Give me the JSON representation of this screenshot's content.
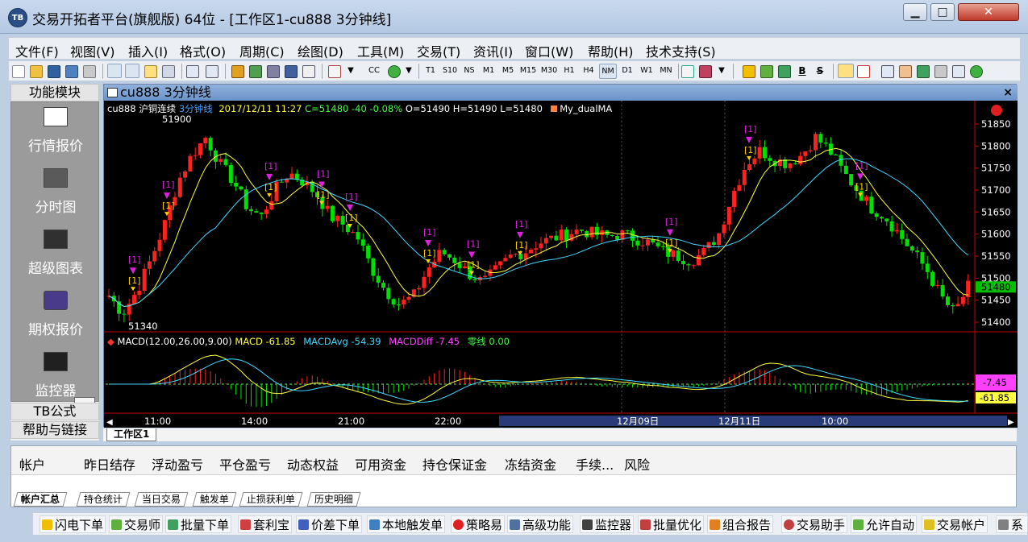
{
  "window": {
    "app_icon_text": "TB",
    "title": "交易开拓者平台(旗舰版) 64位 - [工作区1-cu888 3分钟线]",
    "min_label": "▁",
    "max_label": "□",
    "close_label": "✕"
  },
  "menu": [
    "文件(F)",
    "视图(V)",
    "插入(I)",
    "格式(O)",
    "周期(C)",
    "绘图(D)",
    "工具(M)",
    "交易(T)",
    "资讯(I)",
    "窗口(W)",
    "帮助(H)",
    "技术支持(S)"
  ],
  "toolbar": {
    "cc_label": "CC",
    "periods": [
      "T1",
      "S10",
      "NS",
      "M1",
      "M5",
      "M15",
      "M30",
      "H1",
      "H4",
      "NM",
      "D1",
      "W1",
      "MN"
    ],
    "active_period": "NM",
    "b_label": "B",
    "s_label": "S"
  },
  "sidebar": {
    "header": "功能模块",
    "items": [
      "行情报价",
      "分时图",
      "超级图表",
      "期权报价",
      "监控器"
    ],
    "scroll_glyph": "▼",
    "footer_items": [
      "TB公式",
      "帮助与链接"
    ]
  },
  "chart": {
    "window_title": "cu888 3分钟线",
    "close_label": "×",
    "info": {
      "symbol": "cu888 沪铜连续",
      "period": "3分钟线",
      "datetime": "2017/12/11 11:27",
      "close": "C=51480",
      "change": "-40",
      "change_pct": "-0.08%",
      "ohl": "O=51490 H=51490 L=51480",
      "indicator": "My_dualMA"
    },
    "macd_info": {
      "name": "MACD(12.00,26.00,9.00)",
      "macd": "MACD -61.85",
      "avg": "MACDAvg -54.39",
      "diff": "MACDDiff -7.45",
      "zero": "零线 0.00"
    },
    "price_labels": [
      "51850",
      "51800",
      "51750",
      "51700",
      "51650",
      "51600",
      "51550",
      "51500",
      "51450",
      "51400"
    ],
    "current_price": "51480",
    "high_label": "51900",
    "low_label": "51340",
    "macd_badges": [
      "-7.45",
      "-61.85"
    ],
    "time_labels": [
      "11:00",
      "14:00",
      "21:00",
      "22:00",
      "12月09日",
      "12月11日",
      "10:00"
    ],
    "signal_text": "[1]",
    "colors": {
      "up": "#ff2020",
      "down": "#00e000",
      "ma_fast": "#ffff40",
      "ma_slow": "#40d8ff",
      "signal": "#e020e0",
      "signal_alt": "#ffd000",
      "axis_red": "#c00000"
    }
  },
  "chart_data": {
    "type": "candlestick",
    "title": "cu888 3分钟线",
    "price_axis": [
      51380,
      51870
    ],
    "price_ticks": [
      51850,
      51800,
      51750,
      51700,
      51650,
      51600,
      51550,
      51500,
      51450,
      51400
    ],
    "close_path": [
      51460,
      51420,
      51470,
      51540,
      51620,
      51720,
      51780,
      51820,
      51760,
      51720,
      51660,
      51640,
      51700,
      51740,
      51720,
      51690,
      51640,
      51620,
      51590,
      51520,
      51470,
      51440,
      51460,
      51520,
      51560,
      51540,
      51510,
      51490,
      51520,
      51550,
      51560,
      51580,
      51590,
      51600,
      51610,
      51600,
      51595,
      51600,
      51590,
      51580,
      51560,
      51550,
      51540,
      51560,
      51600,
      51690,
      51760,
      51790,
      51770,
      51760,
      51780,
      51820,
      51790,
      51740,
      51700,
      51660,
      51640,
      51600,
      51560,
      51520,
      51460,
      51420,
      51480
    ],
    "macd": {
      "MACD": -61.85,
      "MACDAvg": -54.39,
      "MACDDiff": -7.45,
      "zero": 0.0
    }
  },
  "workspace_tab": "工作区1",
  "account_panel": {
    "columns": [
      "帐户",
      "昨日结存",
      "浮动盈亏",
      "平仓盈亏",
      "动态权益",
      "可用资金",
      "持仓保证金",
      "冻结资金",
      "手续...",
      "风险"
    ],
    "tabs": [
      "帐户汇总",
      "持仓统计",
      "当日交易",
      "触发单",
      "止损获利单",
      "历史明细"
    ],
    "active_tab": "帐户汇总"
  },
  "taskbar": [
    "闪电下单",
    "交易师",
    "批量下单",
    "套利宝",
    "价差下单",
    "本地触发单",
    "策略易",
    "高级功能",
    "监控器",
    "批量优化",
    "组合报告",
    "交易助手",
    "允许自动",
    "交易帐户",
    "系"
  ]
}
